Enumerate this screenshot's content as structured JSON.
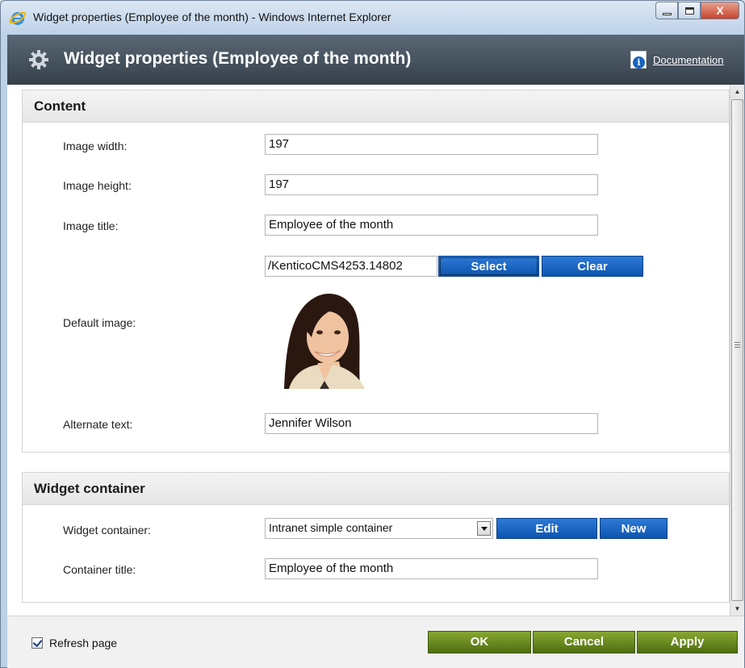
{
  "window": {
    "title": "Widget properties (Employee of the month) - Windows Internet Explorer",
    "close_glyph": "X"
  },
  "header": {
    "title": "Widget properties (Employee of the month)",
    "documentation_label": "Documentation",
    "doc_icon_glyph": "i"
  },
  "content_section": {
    "title": "Content",
    "image_width_label": "Image width:",
    "image_width_value": "197",
    "image_height_label": "Image height:",
    "image_height_value": "197",
    "image_title_label": "Image title:",
    "image_title_value": "Employee of the month",
    "default_image_label": "Default image:",
    "default_image_path": "/KenticoCMS4253.14802",
    "select_label": "Select",
    "clear_label": "Clear",
    "alternate_text_label": "Alternate text:",
    "alternate_text_value": "Jennifer Wilson"
  },
  "container_section": {
    "title": "Widget container",
    "widget_container_label": "Widget container:",
    "widget_container_value": "Intranet simple container",
    "edit_label": "Edit",
    "new_label": "New",
    "container_title_label": "Container title:",
    "container_title_value": "Employee of the month"
  },
  "footer": {
    "refresh_label": "Refresh page",
    "refresh_checked": true,
    "ok_label": "OK",
    "cancel_label": "Cancel",
    "apply_label": "Apply"
  },
  "colors": {
    "header_bg": "#3e4a56",
    "blue_button": "#0c55b0",
    "green_button": "#5b7a16"
  }
}
